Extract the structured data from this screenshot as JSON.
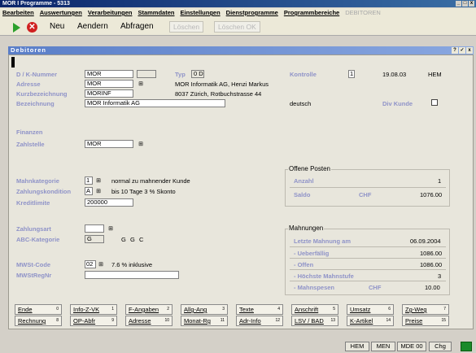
{
  "window": {
    "title": "MOR I Programme - 5313",
    "buttons": [
      "_",
      "□",
      "x"
    ]
  },
  "menu": {
    "items": [
      "Bearbeiten",
      "Auswertungen",
      "Verarbeitungen",
      "Stammdaten",
      "Einstellungen",
      "Dienstprogramme",
      "Programmbereiche"
    ],
    "disabled": "DEBITOREN"
  },
  "toolbar": {
    "stop_glyph": "✕",
    "neu": "Neu",
    "aendern": "Aendern",
    "abfragen": "Abfragen",
    "loeschen": "Löschen",
    "loeschen_ok": "Löschen OK"
  },
  "panel": {
    "title": "Debitoren",
    "buttons": [
      "?",
      "✓",
      "x"
    ]
  },
  "lookup_glyph": "⊞",
  "form": {
    "dk_label": "D / K-Nummer",
    "dk_value": "MOR",
    "typ_label": "Typ",
    "typ_value": "0 D",
    "kontrolle_label": "Kontrolle",
    "kontrolle_value": "1",
    "kontrolle_date": "19.08.03",
    "kontrolle_user": "HEM",
    "adresse_label": "Adresse",
    "adresse_value": "MOR",
    "adresse_text": "MOR Informatik AG, Henzi Markus",
    "kurz_label": "Kurzbezeichnung",
    "kurz_value": "MORINF",
    "kurz_text": "8037 Zürich, Rotbuchstrasse 44",
    "bez_label": "Bezeichnung",
    "bez_value": "MOR Informatik AG",
    "sprache": "deutsch",
    "divkunde_label": "Div Kunde",
    "finanzen_label": "Finanzen",
    "zahlstelle_label": "Zahlstelle",
    "zahlstelle_value": "MOR",
    "mahnkat_label": "Mahnkategorie",
    "mahnkat_value": "1",
    "mahnkat_text": "normal zu mahnender Kunde",
    "zahlkond_label": "Zahlungskondition",
    "zahlkond_value": "A",
    "zahlkond_text": "bis 10 Tage 3 % Skonto",
    "kredit_label": "Kreditlimite",
    "kredit_value": "200000",
    "zahlart_label": "Zahlungsart",
    "zahlart_value": "",
    "abc_label": "ABC-Kategorie",
    "abc_value": "G",
    "abc_g1": "G",
    "abc_g2": "G",
    "abc_c": "C",
    "mwst_label": "MWSt-Code",
    "mwst_value": "02",
    "mwst_text": "7.6 % inklusive",
    "mwstnr_label": "MWStRegNr",
    "mwstnr_value": ""
  },
  "offene": {
    "title": "Offene Posten",
    "anzahl_label": "Anzahl",
    "anzahl_value": "1",
    "saldo_label": "Saldo",
    "saldo_currency": "CHF",
    "saldo_value": "1076.00"
  },
  "mahnungen": {
    "title": "Mahnungen",
    "letzte_label": "Letzte Mahnung am",
    "letzte_value": "06.09.2004",
    "ueber_label": "- Ueberfällig",
    "ueber_value": "1086.00",
    "offen_label": "- Offen",
    "offen_value": "1086.00",
    "hoechste_label": "- Höchste Mahnstufe",
    "hoechste_value": "3",
    "spesen_label": "- Mahnspesen",
    "spesen_currency": "CHF",
    "spesen_value": "10.00"
  },
  "fbuttons": {
    "row1": [
      {
        "label": "Ende",
        "key": "0"
      },
      {
        "label": "Info-Z-VK",
        "key": "1"
      },
      {
        "label": "F-Angaben",
        "key": "2"
      },
      {
        "label": "Allg-Ang",
        "key": "3"
      },
      {
        "label": "Texte",
        "key": "4"
      },
      {
        "label": "Anschrift",
        "key": "5"
      },
      {
        "label": "Umsatz",
        "key": "6"
      },
      {
        "label": "Zg-Weg",
        "key": "7"
      }
    ],
    "row2": [
      {
        "label": "Rechnung",
        "key": "8"
      },
      {
        "label": "OP-Abfr",
        "key": "9"
      },
      {
        "label": "Adresse",
        "key": "10"
      },
      {
        "label": "Monat-Rg",
        "key": "11"
      },
      {
        "label": "Adr-Info",
        "key": "12"
      },
      {
        "label": "LSV / BAD",
        "key": "13"
      },
      {
        "label": "K-Artikel",
        "key": "14"
      },
      {
        "label": "Preise",
        "key": "15"
      }
    ]
  },
  "status": {
    "user": "HEM",
    "mode": "MEN",
    "mde": "MDE 00",
    "chg": "Chg"
  },
  "colors": {
    "label": "#8f93c8",
    "panel_header": "#5a7ec8",
    "titlebar": "#0a246a"
  }
}
